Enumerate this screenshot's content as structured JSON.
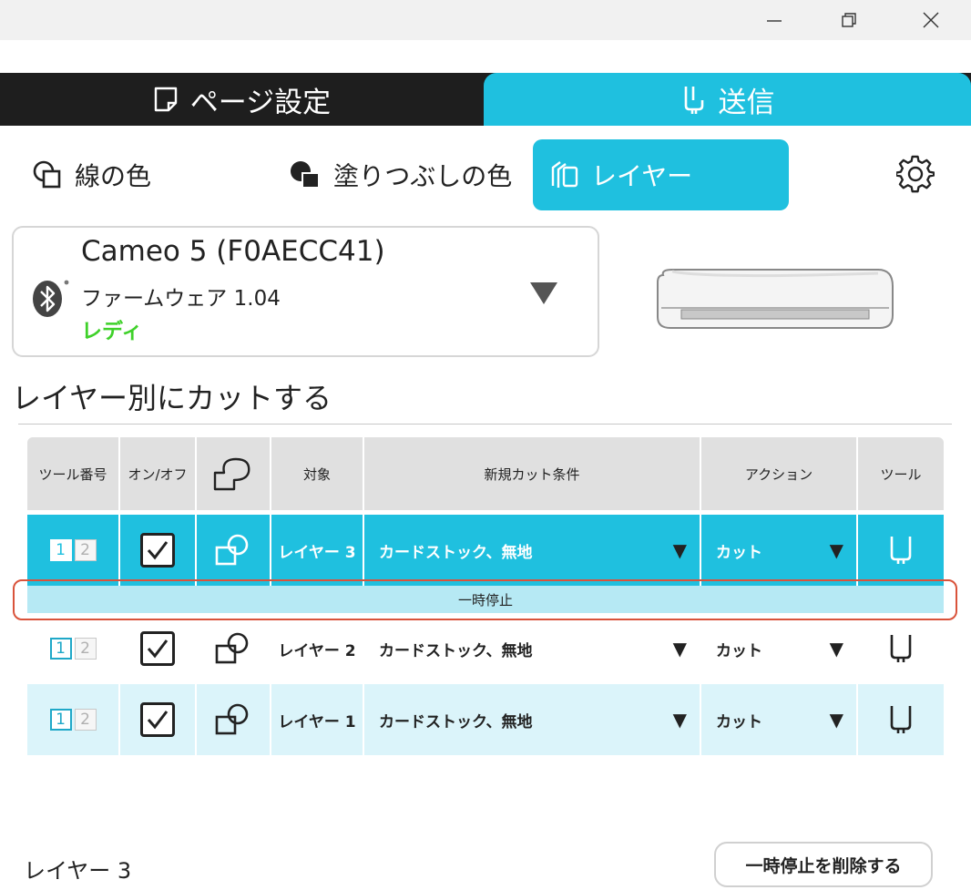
{
  "window": {
    "minimize": "—",
    "maximize": "❐",
    "close": "✕"
  },
  "main_tabs": [
    {
      "label": "ページ設定",
      "icon": "page-icon",
      "active": false
    },
    {
      "label": "送信",
      "icon": "blade-icon",
      "active": true
    }
  ],
  "sub_tabs": [
    {
      "label": "線の色",
      "icon": "line-color-icon",
      "active": false
    },
    {
      "label": "塗りつぶしの色",
      "icon": "fill-color-icon",
      "active": false
    },
    {
      "label": "レイヤー",
      "icon": "layers-icon",
      "active": true
    }
  ],
  "device": {
    "name": "Cameo 5 (F0AECC41)",
    "firmware": "ファームウェア 1.04",
    "status": "レディ",
    "status_color": "#3fd12a"
  },
  "section_title": "レイヤー別にカットする",
  "table": {
    "headers": {
      "tool_number": "ツール番号",
      "on_off": "オン/オフ",
      "target": "対象",
      "condition": "新規カット条件",
      "action": "アクション",
      "tool": "ツール"
    },
    "rows": [
      {
        "tool_nums": [
          "1",
          "2"
        ],
        "checked": true,
        "target": "レイヤー 3",
        "condition": "カードストック、無地",
        "action": "カット",
        "selected": true
      },
      {
        "tool_nums": [
          "1",
          "2"
        ],
        "checked": true,
        "target": "レイヤー 2",
        "condition": "カードストック、無地",
        "action": "カット",
        "selected": false
      },
      {
        "tool_nums": [
          "1",
          "2"
        ],
        "checked": true,
        "target": "レイヤー 1",
        "condition": "カードストック、無地",
        "action": "カット",
        "selected": false
      }
    ],
    "pause_label": "一時停止",
    "dropdown_arrow": "▼"
  },
  "footer": {
    "current_layer": "レイヤー 3",
    "delete_pause_button": "一時停止を削除する"
  },
  "colors": {
    "accent": "#1fc0df",
    "highlight_border": "#d9533b",
    "dark_bar": "#1e1e1e"
  }
}
